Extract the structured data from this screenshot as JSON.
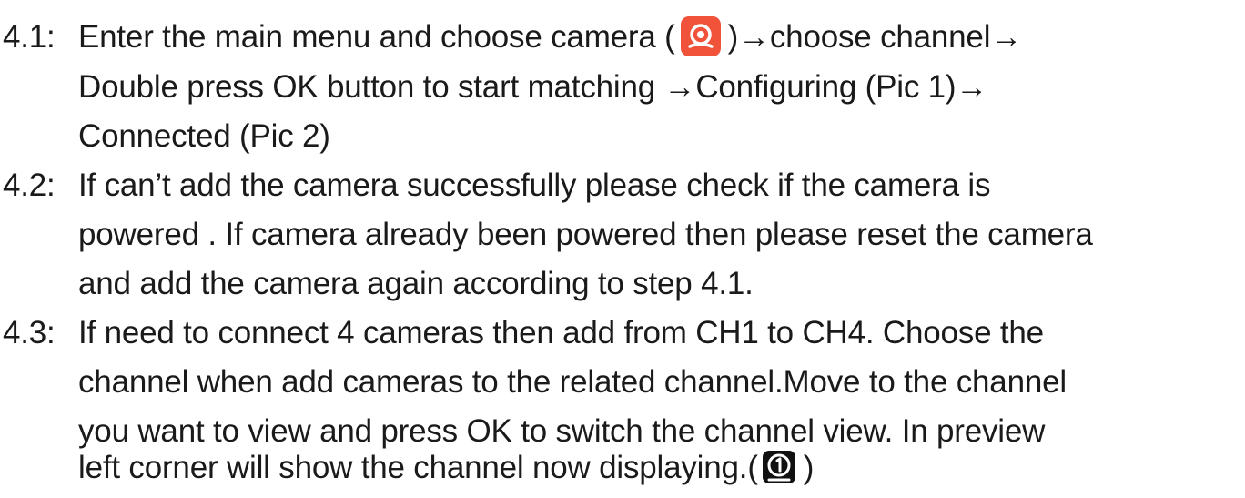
{
  "steps": [
    {
      "number": "4.1:",
      "line1_before_icon": "Enter the main menu and choose camera (",
      "line1_after_icon": ")→choose channel→",
      "line2": "Double press OK button to start matching →Configuring (Pic 1)→",
      "line3": "Connected (Pic 2)",
      "icon": "camera-app-icon"
    },
    {
      "number": "4.2:",
      "line1": "If can’t add the camera successfully please check if the camera is",
      "line2": "powered . If camera already been powered then please reset the camera",
      "line3": "and add the camera again according to step 4.1."
    },
    {
      "number": "4.3:",
      "line1": "If need to connect 4 cameras then add from CH1 to CH4. Choose the",
      "line2": "channel when add cameras to the related channel.Move to the channel",
      "line3": "you want to view and press OK to switch the channel view. In preview",
      "line4_before_icon": "left corner will show the channel now displaying.(",
      "line4_after_icon": ")",
      "icon": "channel-1-icon"
    }
  ],
  "colors": {
    "text": "#1a1a1a",
    "camera_icon_bg": "#f0533a",
    "channel_icon_bg": "#111111"
  }
}
